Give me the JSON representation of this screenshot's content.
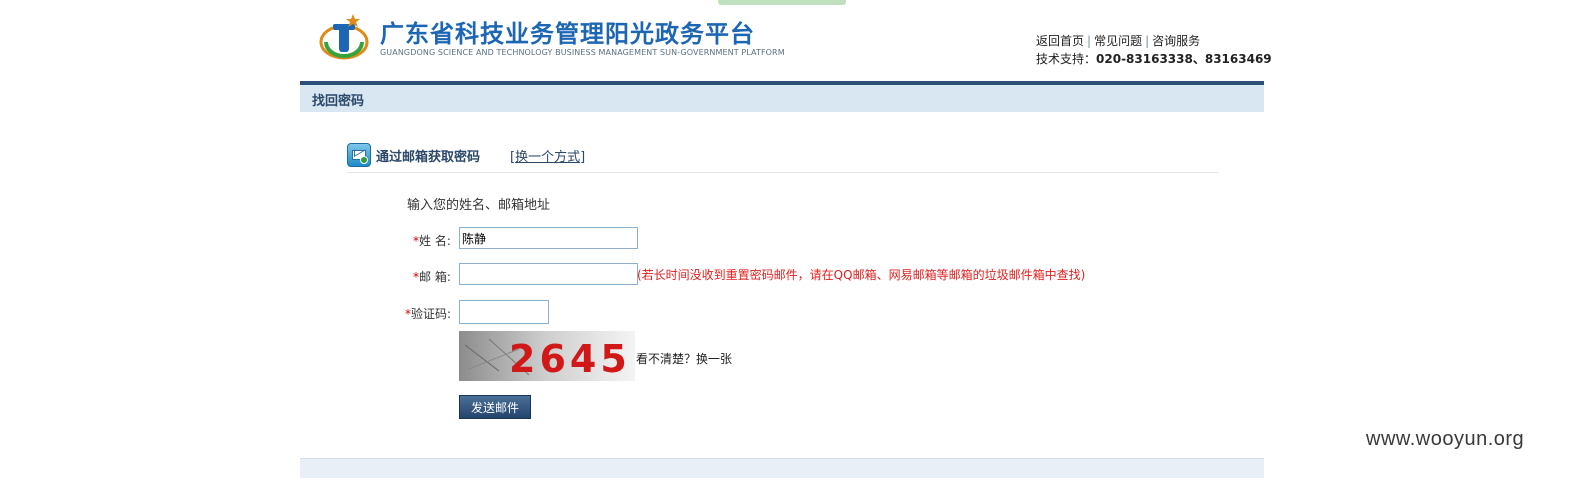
{
  "header": {
    "site_title": "广东省科技业务管理阳光政务平台",
    "site_subtitle": "GUANGDONG SCIENCE AND TECHNOLOGY BUSINESS MANAGEMENT SUN-GOVERNMENT PLATFORM",
    "links": [
      "返回首页",
      "常见问题",
      "咨询服务"
    ],
    "support_label": "技术支持：",
    "support_phone": "020-83163338、83163469"
  },
  "section": {
    "title": "找回密码"
  },
  "method": {
    "title": "通过邮箱获取密码",
    "switch_link": "换一个方式",
    "switch_open": "[",
    "switch_close": "]"
  },
  "form": {
    "instruction": "输入您的姓名、邮箱地址",
    "required_mark": "*",
    "name_label": "姓 名:",
    "name_value": "陈静",
    "email_label": "邮 箱:",
    "email_value": "",
    "email_hint": "(若长时间没收到重置密码邮件，请在QQ邮箱、网易邮箱等邮箱的垃圾邮件箱中查找)",
    "captcha_label": "验证码:",
    "captcha_value": "",
    "captcha_text": "2645",
    "captcha_refresh": "看不清楚？换一张",
    "submit_label": "发送邮件"
  },
  "watermark": "www.wooyun.org",
  "colors": {
    "brand_blue": "#1d66b3",
    "section_line": "#2b4f76",
    "section_bar": "#d9e7f3",
    "hint_red": "#e02020",
    "button": "#2d4d76"
  }
}
